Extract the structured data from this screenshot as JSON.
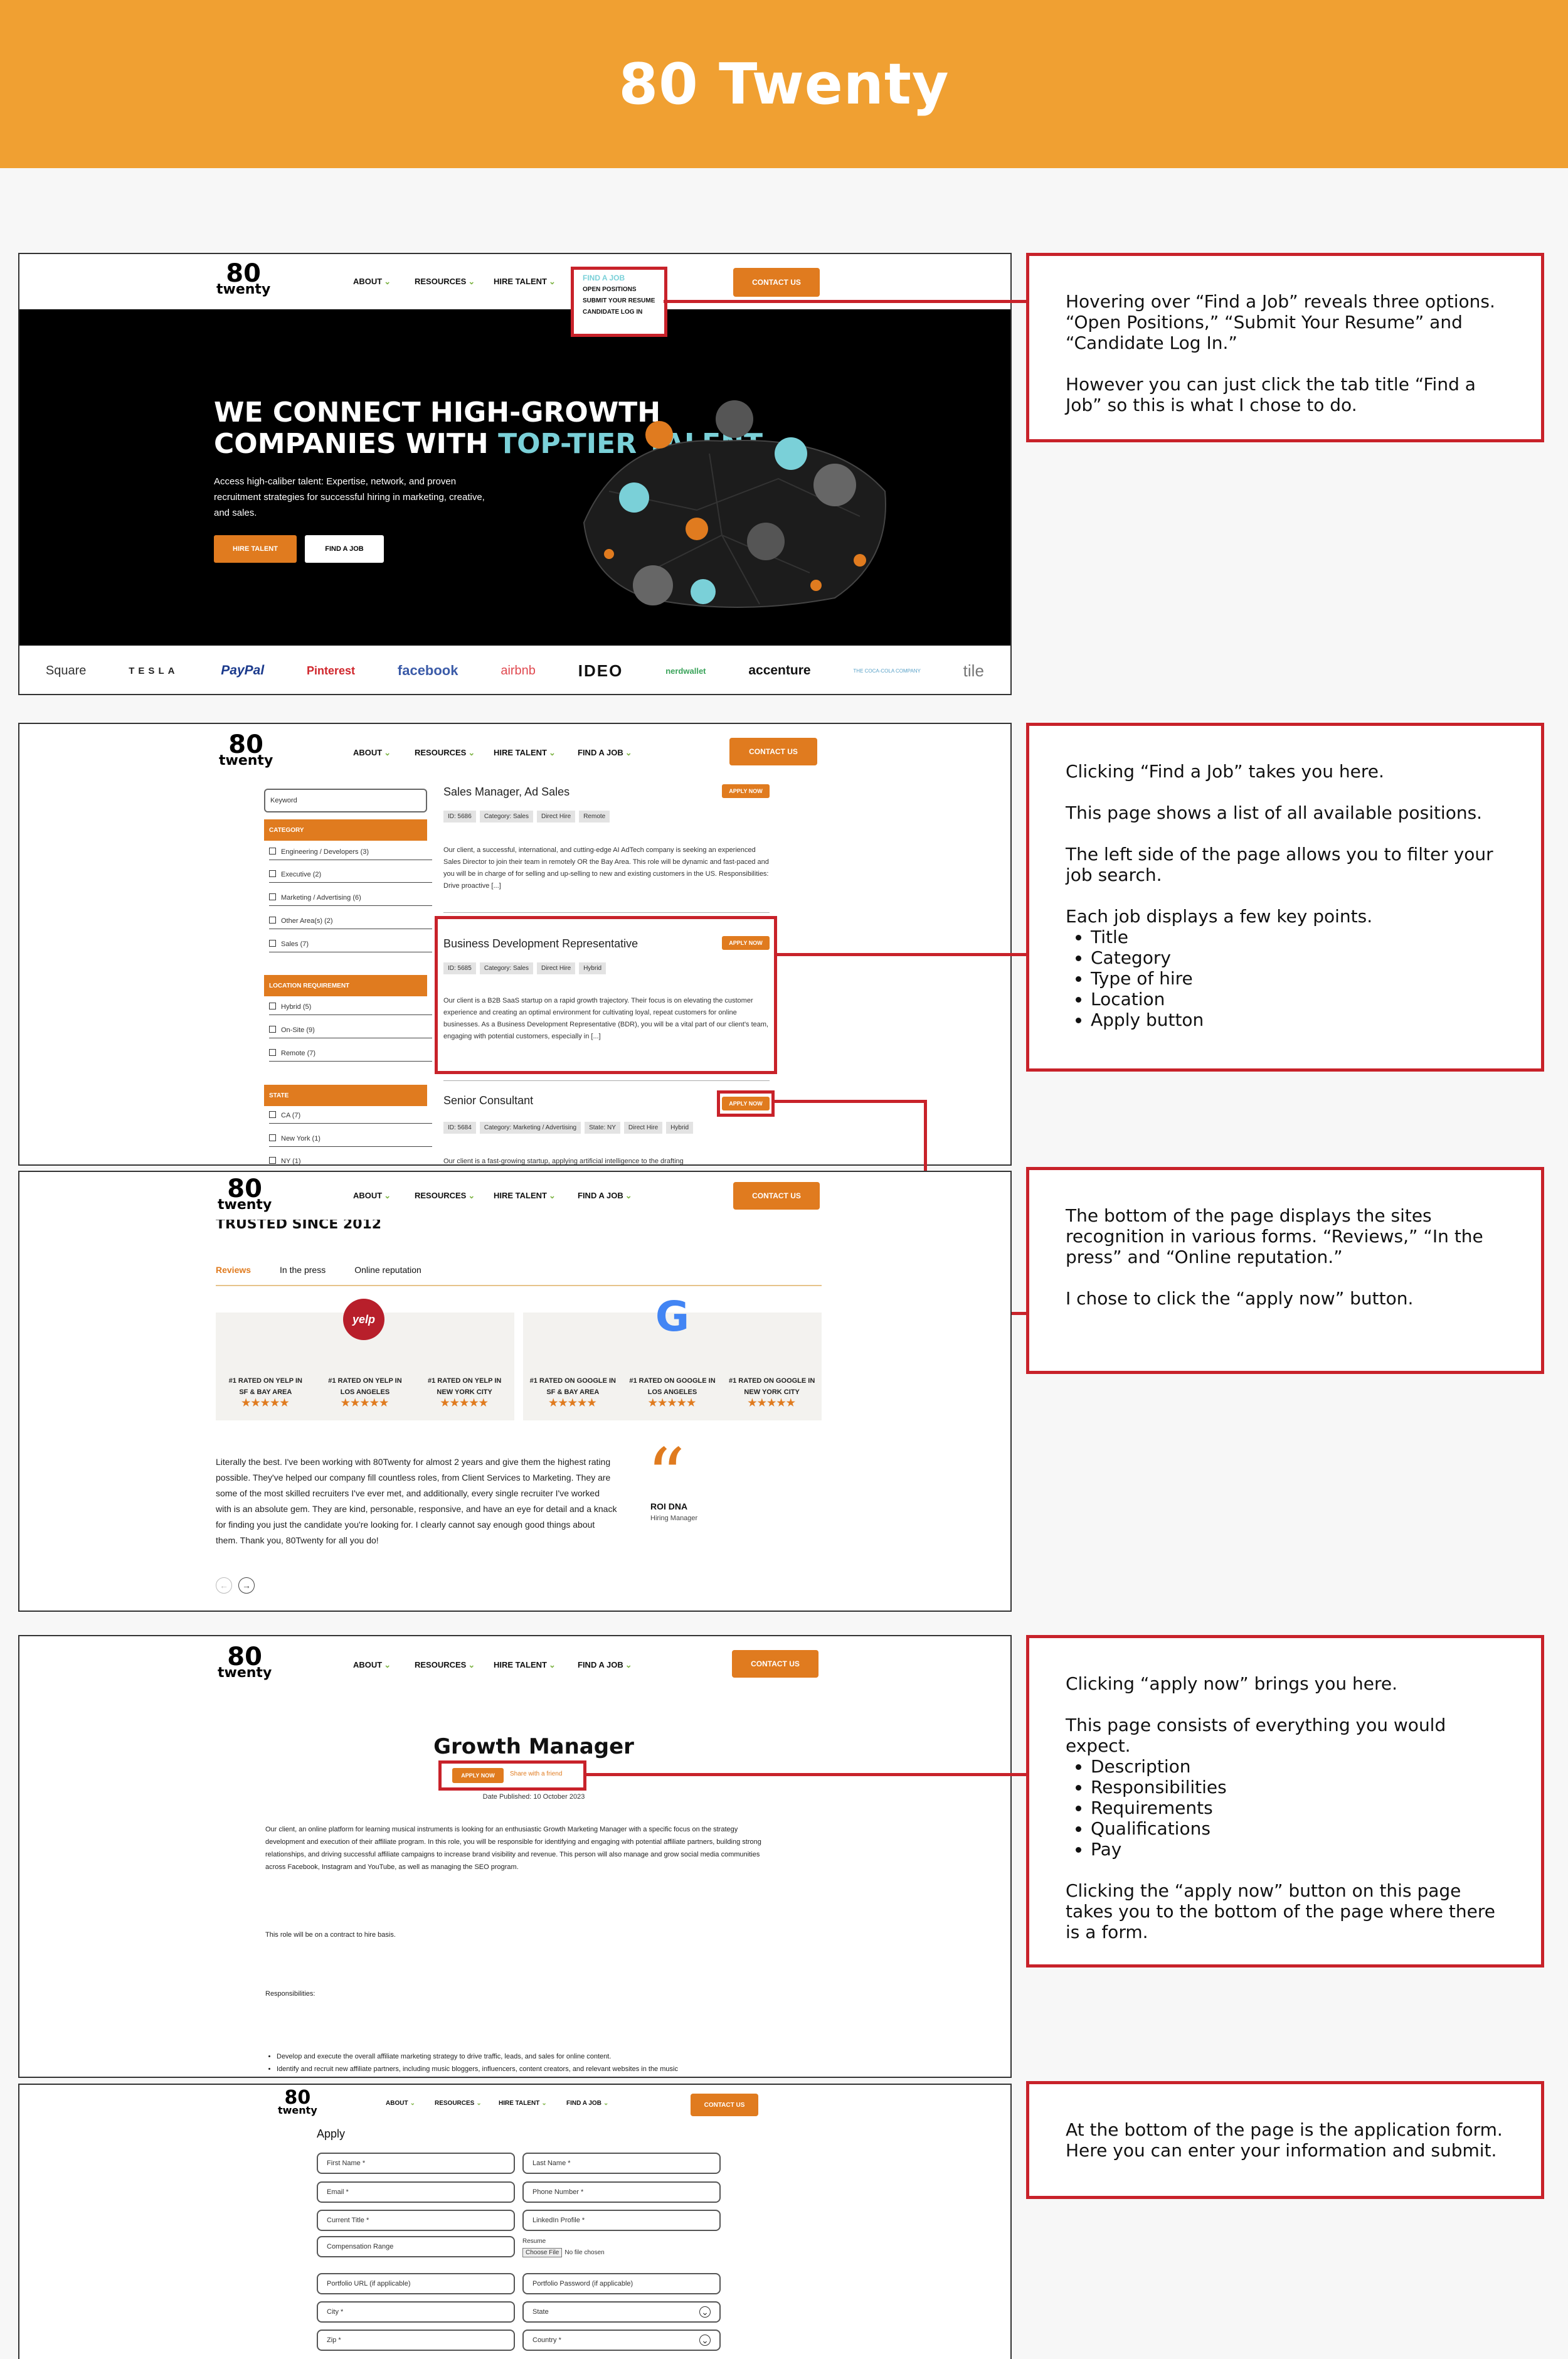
{
  "header": {
    "title": "80 Twenty"
  },
  "colors": {
    "banner": "#f0a032",
    "accent": "#e07b1f",
    "teal": "#7ad0d8",
    "annotation": "#c8222a"
  },
  "site": {
    "logo_number": "80",
    "logo_word": "twenty",
    "nav": [
      "ABOUT",
      "RESOURCES",
      "HIRE TALENT",
      "FIND A JOB"
    ],
    "contact": "CONTACT US"
  },
  "panel1": {
    "dropdown": {
      "title": "FIND A JOB",
      "items": [
        "OPEN POSITIONS",
        "SUBMIT YOUR RESUME",
        "CANDIDATE LOG IN"
      ]
    },
    "headline_1": "WE CONNECT HIGH-GROWTH",
    "headline_2": "COMPANIES WITH",
    "headline_teal": "TOP-TIER TALENT",
    "sub": "Access high-caliber talent: Expertise, network, and proven recruitment strategies for successful hiring in marketing, creative, and sales.",
    "btn_hire": "HIRE TALENT",
    "btn_find": "FIND A JOB",
    "logos": [
      "Square",
      "TESLA",
      "PayPal",
      "Pinterest",
      "facebook",
      "airbnb",
      "IDEO",
      "nerdwallet",
      "accenture",
      "THE COCA-COLA COMPANY",
      "tile"
    ]
  },
  "note1": {
    "p1": "Hovering over “Find a Job” reveals three options. “Open Positions,” “Submit Your Resume” and “Candidate Log In.”",
    "p2": "However you can just click the tab title “Find a Job” so this is what I chose to do."
  },
  "panel2": {
    "keyword": "Keyword",
    "filters": [
      {
        "title": "CATEGORY",
        "items": [
          "Engineering / Developers (3)",
          "Executive (2)",
          "Marketing / Advertising (6)",
          "Other Area(s) (2)",
          "Sales (7)"
        ]
      },
      {
        "title": "LOCATION REQUIREMENT",
        "items": [
          "Hybrid (5)",
          "On-Site (9)",
          "Remote (7)"
        ]
      },
      {
        "title": "STATE",
        "items": [
          "CA (7)",
          "New York (1)",
          "NY (1)"
        ]
      }
    ],
    "apply_label": "APPLY NOW",
    "jobs": [
      {
        "title": "Sales Manager, Ad Sales",
        "tags": [
          "ID: 5686",
          "Category: Sales",
          "Direct Hire",
          "Remote"
        ],
        "desc": "Our client, a successful, international, and cutting-edge AI AdTech company is seeking an experienced Sales Director to join their team in remotely OR the Bay Area. This role will be dynamic and fast-paced and you will be in charge of for selling and up-selling to new and existing customers in the US. Responsibilities: Drive proactive [...]"
      },
      {
        "title": "Business Development Representative",
        "tags": [
          "ID: 5685",
          "Category: Sales",
          "Direct Hire",
          "Hybrid"
        ],
        "desc": "Our client is a B2B SaaS startup on a rapid growth trajectory. Their focus is on elevating the customer experience and creating an optimal environment for cultivating loyal, repeat customers for online businesses. As a Business Development Representative (BDR), you will be a vital part of our client's team, engaging with potential customers, especially in [...]"
      },
      {
        "title": "Senior Consultant",
        "tags": [
          "ID: 5684",
          "Category: Marketing / Advertising",
          "State: NY",
          "Direct Hire",
          "Hybrid"
        ],
        "desc": "Our client is a fast-growing startup, applying artificial intelligence to the drafting"
      }
    ]
  },
  "note2": {
    "p1": "Clicking “Find a Job” takes you here.",
    "p2": "This page shows a list of all available positions.",
    "p3": "The left side of the page allows you to filter your job search.",
    "p4": "Each job displays a few key points.",
    "points": [
      "Title",
      "Category",
      "Type of hire",
      "Location",
      "Apply button"
    ]
  },
  "panel3": {
    "heading": "TRUSTED SINCE 2012",
    "tabs": [
      "Reviews",
      "In the press",
      "Online reputation"
    ],
    "yelp": [
      "#1 RATED ON YELP IN SF & BAY AREA",
      "#1 RATED ON YELP IN LOS ANGELES",
      "#1 RATED ON YELP IN NEW YORK CITY"
    ],
    "google": [
      "#1 RATED ON GOOGLE IN SF & BAY AREA",
      "#1 RATED ON GOOGLE IN LOS ANGELES",
      "#1 RATED ON GOOGLE IN NEW YORK CITY"
    ],
    "stars": "★★★★★",
    "yelp_badge": "yelp",
    "google_badge": "G",
    "quote": "Literally the best. I've been working with 80Twenty for almost 2 years and give them the highest rating possible. They've helped our company fill countless roles, from Client Services to Marketing. They are some of the most skilled recruiters I've ever met, and additionally, every single recruiter I've worked with is an absolute gem. They are kind, personable, responsive, and have an eye for detail and a knack for finding you just the candidate you're looking for. I clearly cannot say enough good things about them. Thank you, 80Twenty for all you do!",
    "author": "ROI DNA",
    "author_role": "Hiring Manager"
  },
  "note3": {
    "p1": "The bottom of the page displays the sites recognition in various forms. “Reviews,” “In the press” and “Online reputation.”",
    "p2": "I chose to click the “apply now” button."
  },
  "panel4": {
    "title": "Growth Manager",
    "apply": "APPLY NOW",
    "share": "Share with a friend",
    "date": "Date Published: 10 October 2023",
    "desc": "Our client, an online platform for learning musical instruments is looking for an enthusiastic Growth Marketing Manager with a specific focus on the strategy development and execution of their affiliate program. In this role, you will be responsible for identifying and engaging with potential affiliate partners, building strong relationships, and driving successful affiliate campaigns to increase brand visibility and revenue. This person will also manage and grow social media communities across Facebook, Instagram and YouTube, as well as managing the SEO program.",
    "contract": "This role will be on a contract to hire basis.",
    "resp_label": "Responsibilities:",
    "bullets": [
      "Develop and execute the overall affiliate marketing strategy to drive traffic, leads, and sales for online content.",
      "Identify and recruit new affiliate partners, including music bloggers, influencers, content creators, and relevant websites in the music"
    ]
  },
  "note4": {
    "p1": "Clicking “apply now” brings you here.",
    "p2": "This page consists of everything you would expect.",
    "points": [
      "Description",
      "Responsibilities",
      "Requirements",
      "Qualifications",
      "Pay"
    ],
    "p3": "Clicking the “apply now” button on this page takes you to the bottom of the page where there is a form."
  },
  "panel5": {
    "heading": "Apply",
    "fields": [
      "First Name *",
      "Last Name *",
      "Email *",
      "Phone Number *",
      "Current Title *",
      "LinkedIn Profile *",
      "Compensation Range",
      "Portfolio URL (if applicable)",
      "Portfolio Password (if applicable)",
      "City *",
      "State",
      "Zip *",
      "Country *"
    ],
    "resume_label": "Resume",
    "choose_file": "Choose File",
    "no_file": "No file chosen"
  },
  "note5": {
    "p1": "At the bottom of the page is the application form. Here you can enter your information and submit."
  }
}
